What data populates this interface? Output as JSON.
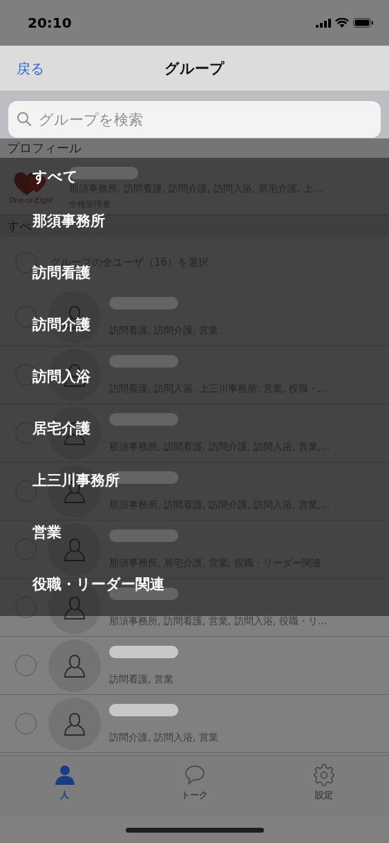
{
  "status_bar": {
    "time": "20:10"
  },
  "nav": {
    "back": "戻る",
    "title": "グループ"
  },
  "search": {
    "placeholder": "グループを検索"
  },
  "profile_section": {
    "header": "プロフィール",
    "logo_text": "One-or-Eight",
    "groups": "那須事務所, 訪問看護, 訪問介護, 訪問入浴, 居宅介護, 上…",
    "role": "全権管理者"
  },
  "all_section": {
    "header": "すべ",
    "select_all": {
      "label": "グループの全ユーザ（16）を選択",
      "checked": false
    }
  },
  "users": [
    {
      "groups": "訪問看護, 訪問介護, 営業",
      "checked": false
    },
    {
      "groups": "訪問看護, 訪問入浴, 上三川事務所, 営業, 役職・…",
      "checked": false
    },
    {
      "groups": "那須事務所, 訪問看護, 訪問介護, 訪問入浴, 営業,...",
      "checked": false
    },
    {
      "groups": "那須事務所, 訪問看護, 訪問介護, 訪問入浴, 営業,...",
      "checked": false
    },
    {
      "groups": "那須事務所, 居宅介護, 営業, 役職・リーダー関連",
      "checked": false
    },
    {
      "groups": "那須事務所, 訪問看護, 営業, 訪問入浴, 役職・リ…",
      "checked": false
    },
    {
      "groups": "訪問看護, 営業",
      "checked": false
    },
    {
      "groups": "訪問介護, 訪問入浴, 営業",
      "checked": false
    }
  ],
  "group_menu": [
    {
      "label": "すべて"
    },
    {
      "label": "那須事務所"
    },
    {
      "label": "訪問看護"
    },
    {
      "label": "訪問介護"
    },
    {
      "label": "訪問入浴"
    },
    {
      "label": "居宅介護"
    },
    {
      "label": "上三川事務所"
    },
    {
      "label": "営業"
    },
    {
      "label": "役職・リーダー関連"
    }
  ],
  "tab_bar": [
    {
      "kind": "person",
      "label": "人",
      "selected": true
    },
    {
      "kind": "chat",
      "label": "トーク",
      "selected": false
    },
    {
      "kind": "settings",
      "label": "設定",
      "selected": false
    }
  ]
}
